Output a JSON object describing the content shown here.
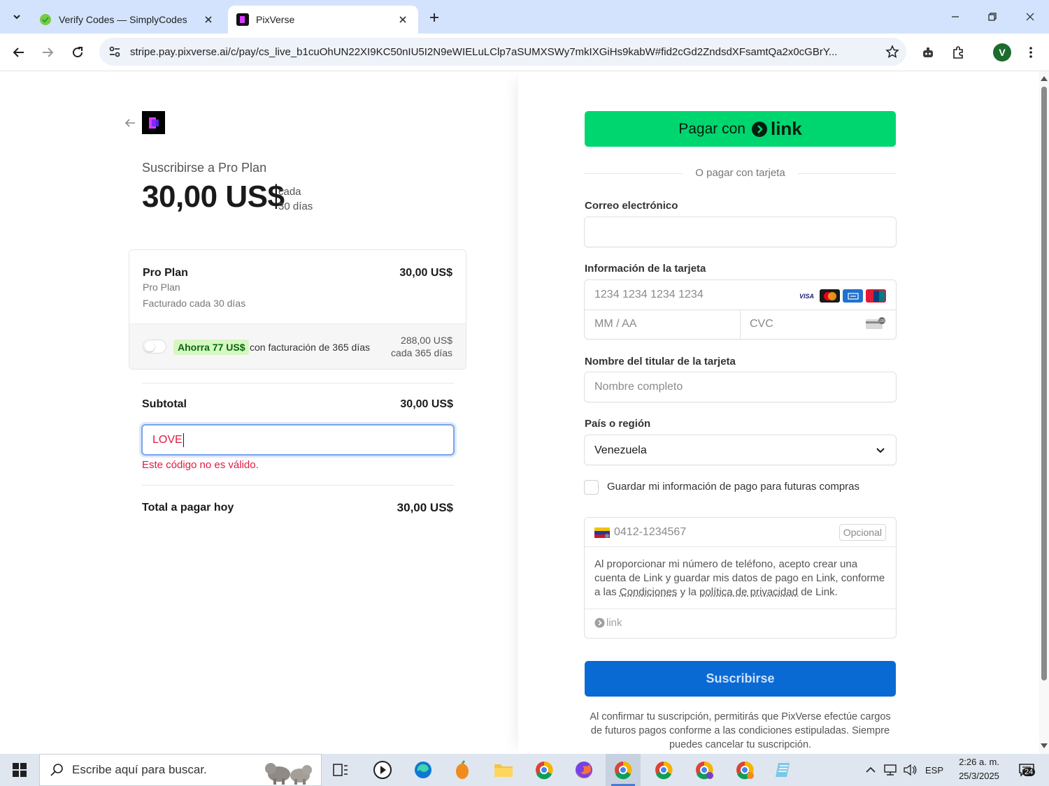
{
  "browser": {
    "tabs": [
      {
        "title": "Verify Codes — SimplyCodes",
        "active": false
      },
      {
        "title": "PixVerse",
        "active": true
      }
    ],
    "url": "stripe.pay.pixverse.ai/c/pay/cs_live_b1cuOhUN22XI9KC50nIU5I2N9eWIELuLClp7aSUMXSWy7mkIXGiHs9kabW#fid2cGd2ZndsdXFsamtQa2x0cGBrY...",
    "profile_initial": "V"
  },
  "summary": {
    "subscribe_label": "Suscribirse a Pro Plan",
    "price": "30,00 US$",
    "period_line1": "cada",
    "period_line2": "30 días",
    "plan_name": "Pro Plan",
    "plan_desc": "Pro Plan",
    "plan_billing": "Facturado cada 30 días",
    "plan_price": "30,00 US$",
    "save_badge": "Ahorra 77 US$",
    "save_text": "con facturación de 365 días",
    "annual_price_line1": "288,00 US$",
    "annual_price_line2": "cada 365 días",
    "subtotal_label": "Subtotal",
    "subtotal_value": "30,00 US$",
    "promo_value": "LOVE",
    "promo_error": "Este código no es válido.",
    "total_label": "Total a pagar hoy",
    "total_value": "30,00 US$"
  },
  "form": {
    "link_button_prefix": "Pagar con",
    "link_button_logo": "link",
    "divider_text": "O pagar con tarjeta",
    "email_label": "Correo electrónico",
    "email_value": "",
    "card_label": "Información de la tarjeta",
    "card_number_placeholder": "1234 1234 1234 1234",
    "expiry_placeholder": "MM / AA",
    "cvc_placeholder": "CVC",
    "card_brands": [
      "VISA",
      "mastercard",
      "amex",
      "unionpay"
    ],
    "cardholder_label": "Nombre del titular de la tarjeta",
    "cardholder_placeholder": "Nombre completo",
    "country_label": "País o región",
    "country_value": "Venezuela",
    "save_info_label": "Guardar mi información de pago para futuras compras",
    "phone_placeholder": "0412-1234567",
    "optional_label": "Opcional",
    "link_terms_1": "Al proporcionar mi número de teléfono, acepto crear una cuenta de Link y guardar mis datos de pago en Link, conforme a las ",
    "link_terms_conditions": "Condiciones",
    "link_terms_2": " y la ",
    "link_terms_privacy": "política de privacidad",
    "link_terms_3": " de Link.",
    "link_mini_logo": "link",
    "subscribe_button": "Suscribirse",
    "legal_text": "Al confirmar tu suscripción, permitirás que PixVerse efectúe cargos de futuros pagos conforme a las condiciones estipuladas. Siempre puedes cancelar tu suscripción."
  },
  "taskbar": {
    "search_placeholder": "Escribe aquí para buscar.",
    "language": "ESP",
    "time": "2:26 a. m.",
    "date": "25/3/2025",
    "notification_count": "24"
  },
  "colors": {
    "link_green": "#00d66f",
    "subscribe_blue": "#0a6ad4",
    "error_red": "#df1b41",
    "save_badge_bg": "#d7f7c2",
    "tabstrip_bg": "#d3e3fd"
  }
}
